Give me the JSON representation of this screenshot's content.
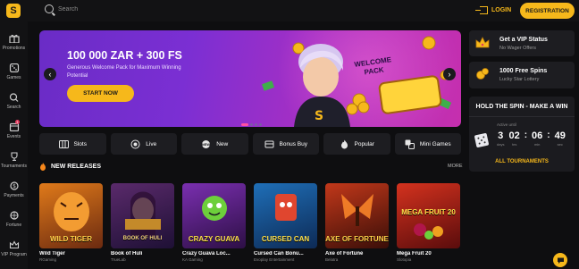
{
  "header": {
    "logo_letter": "S",
    "search_placeholder": "Search",
    "login_label": "LOGIN",
    "register_label": "REGISTRATION"
  },
  "sidebar": {
    "items": [
      {
        "label": "Promotions",
        "icon": "gift-icon"
      },
      {
        "label": "Games",
        "icon": "dice-icon"
      },
      {
        "label": "Search",
        "icon": "search-icon"
      },
      {
        "label": "Events",
        "icon": "calendar-icon",
        "badge": "1"
      },
      {
        "label": "Tournaments",
        "icon": "trophy-icon"
      },
      {
        "label": "Payments",
        "icon": "payments-icon"
      },
      {
        "label": "Fortune",
        "icon": "wheel-icon"
      },
      {
        "label": "VIP Program",
        "icon": "crown-icon"
      }
    ]
  },
  "banner": {
    "title": "100 000 ZAR + 300 FS",
    "subtitle": "Generous Welcome Pack for Maximum Winning Potential",
    "cta": "START NOW",
    "sign_text": "WELCOME PACK",
    "slides": 4,
    "active_slide": 1
  },
  "promos": [
    {
      "title": "Get a VIP Status",
      "sub": "No Wager Offers",
      "icon": "crown-icon"
    },
    {
      "title": "1000 Free Spins",
      "sub": "Lucky Star Lottery",
      "icon": "coins-icon"
    }
  ],
  "tournament": {
    "title": "HOLD THE SPIN - MAKE A WIN",
    "active_until": "Active until",
    "timer": [
      {
        "value": "3",
        "unit": "days"
      },
      {
        "value": "02",
        "unit": "hrs"
      },
      {
        "value": "06",
        "unit": "min"
      },
      {
        "value": "49",
        "unit": "sec"
      }
    ],
    "link": "ALL TOURNAMENTS"
  },
  "categories": [
    {
      "label": "Slots",
      "icon": "slots-icon"
    },
    {
      "label": "Live",
      "icon": "live-icon"
    },
    {
      "label": "New",
      "icon": "new-icon"
    },
    {
      "label": "Bonus Buy",
      "icon": "bonus-buy-icon"
    },
    {
      "label": "Popular",
      "icon": "fire-icon"
    },
    {
      "label": "Mini Games",
      "icon": "mini-games-icon"
    }
  ],
  "new_releases": {
    "title": "NEW RELEASES",
    "more": "MORE",
    "games": [
      {
        "name": "Wild Tiger",
        "provider": "RGaming",
        "thumb_title": "WILD TIGER",
        "color1": "#e07a1a",
        "color2": "#6b2a10"
      },
      {
        "name": "Book of Huli",
        "provider": "TrueLab",
        "thumb_title": "BOOK OF HULI",
        "color1": "#5a2a6b",
        "color2": "#1e1035"
      },
      {
        "name": "Crazy Guava Loc...",
        "provider": "KA Gaming",
        "thumb_title": "CRAZY GUAVA",
        "color1": "#7a2fb0",
        "color2": "#2d0f45"
      },
      {
        "name": "Cursed Can Bonu...",
        "provider": "Evoplay Entertainment",
        "thumb_title": "CURSED CAN",
        "color1": "#1f6fb8",
        "color2": "#0d2a55"
      },
      {
        "name": "Axe of Fortune",
        "provider": "Belatra",
        "thumb_title": "AXE OF FORTUNE",
        "color1": "#c2381a",
        "color2": "#3a0e08"
      },
      {
        "name": "Mega Fruit 20",
        "provider": "Slotopia",
        "thumb_title": "MEGA FRUIT 20",
        "color1": "#d4321e",
        "color2": "#5a0c0c"
      }
    ]
  },
  "colors": {
    "accent": "#f6b81b",
    "bg": "#0e0e10",
    "card": "#1d1d21"
  }
}
